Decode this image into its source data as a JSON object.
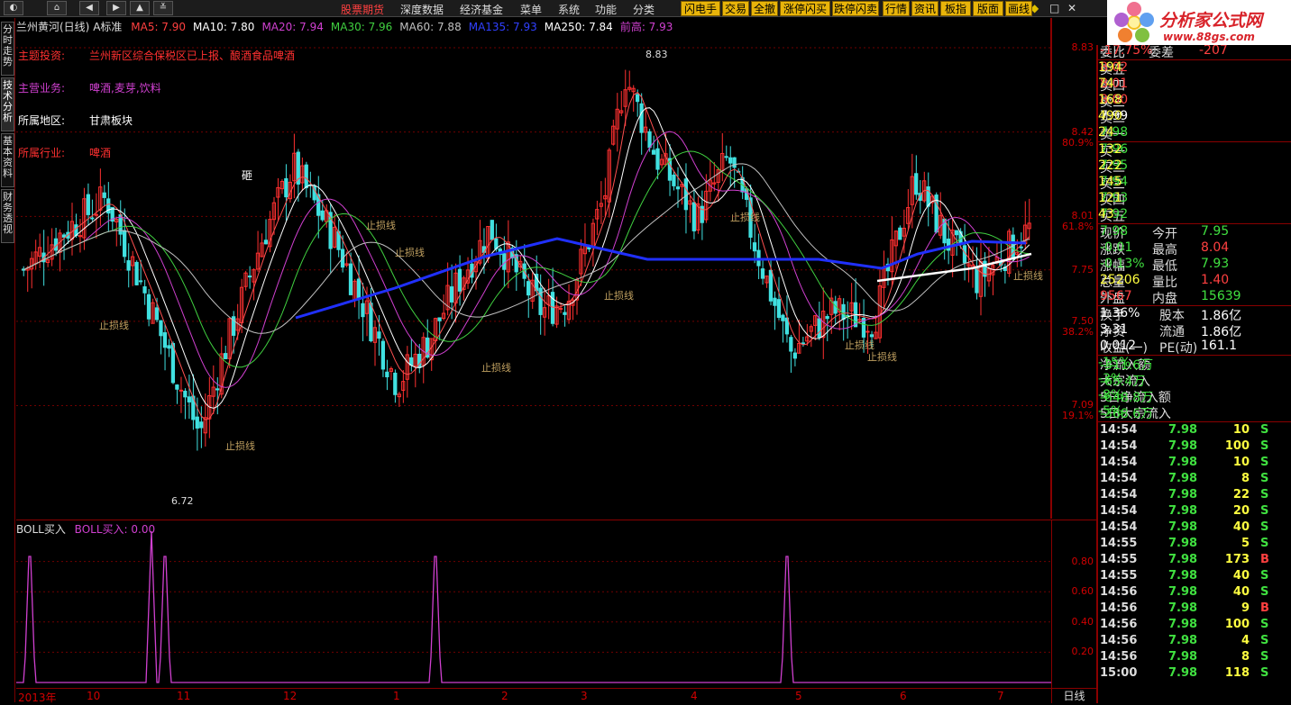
{
  "toolbar": {
    "nav_icons": [
      "home-icon",
      "back-icon",
      "forward-icon",
      "up-icon",
      "down-icon",
      "menu-expand-icon"
    ],
    "menus": [
      "股票期货",
      "深度数据",
      "经济基金",
      "菜单",
      "系统",
      "功能",
      "分类"
    ],
    "buttons": [
      "闪电手",
      "交易",
      "全撤",
      "涨停闪买",
      "跌停闪卖",
      "行情",
      "资讯",
      "板指",
      "版面",
      "画线"
    ],
    "window_controls": [
      "◆",
      "□",
      "✕"
    ]
  },
  "logo": {
    "title": "分析家公式网",
    "url": "www.88gs.com"
  },
  "side_tabs": [
    "分时走势",
    "技术分析",
    "基本资料",
    "财务透视"
  ],
  "main_chart": {
    "stock_title": "兰州黄河(日线)",
    "mode": "A标准",
    "ma_labels": [
      {
        "text": "MA5: 7.90",
        "color": "#ff4040"
      },
      {
        "text": "MA10: 7.80",
        "color": "#ffffff"
      },
      {
        "text": "MA20: 7.94",
        "color": "#d040d0"
      },
      {
        "text": "MA30: 7.96",
        "color": "#40d040"
      },
      {
        "text": "MA60: 7.88",
        "color": "#c0c0c0"
      },
      {
        "text": "MA135: 7.93",
        "color": "#3040ff"
      },
      {
        "text": "MA250: 7.84",
        "color": "#ffffff"
      },
      {
        "text": "前高: 7.93",
        "color": "#d040d0"
      }
    ],
    "info": [
      {
        "label": "主题投资:",
        "value": "兰州新区综合保税区已上报、酿酒食品啤酒",
        "lcolor": "#ff3030",
        "vcolor": "#ff3030"
      },
      {
        "label": "主营业务:",
        "value": "啤酒,麦芽,饮料",
        "lcolor": "#d040d0",
        "vcolor": "#d040d0"
      },
      {
        "label": "所属地区:",
        "value": "甘肃板块",
        "lcolor": "#ffffff",
        "vcolor": "#ffffff"
      },
      {
        "label": "所属行业:",
        "value": "啤酒",
        "lcolor": "#ff3030",
        "vcolor": "#ff3030"
      }
    ],
    "annotations": {
      "high": "8.83",
      "low": "6.72",
      "stop": "止损线",
      "char": "砸"
    },
    "y_labels": [
      "8.83",
      "8.42",
      "80.9%",
      "8.01",
      "61.8%",
      "7.75",
      "7.50",
      "38.2%",
      "7.09",
      "19.1%"
    ]
  },
  "sub_chart": {
    "title": "BOLL买入",
    "value_label": "BOLL买入: 0.00",
    "y_labels": [
      "0.80",
      "0.60",
      "0.40",
      "0.20"
    ]
  },
  "date_axis": [
    "2013年",
    "10",
    "11",
    "12",
    "1",
    "2",
    "3",
    "4",
    "5",
    "6",
    "7"
  ],
  "period": "日线",
  "quote": {
    "header": {
      "label": "委比",
      "value": "-17.75%",
      "label2": "委差",
      "value2": "-207"
    },
    "asks": [
      {
        "label": "卖五",
        "price": "8.02",
        "vol": "194"
      },
      {
        "label": "卖四",
        "price": "8.01",
        "vol": "74"
      },
      {
        "label": "卖三",
        "price": "8.00",
        "vol": "168"
      },
      {
        "label": "卖二",
        "price": "7.99",
        "vol": "490"
      },
      {
        "label": "卖一",
        "price": "7.98",
        "vol": "24"
      }
    ],
    "bids": [
      {
        "label": "买一",
        "price": "7.96",
        "vol": "132"
      },
      {
        "label": "买二",
        "price": "7.95",
        "vol": "222"
      },
      {
        "label": "买三",
        "price": "7.94",
        "vol": "145"
      },
      {
        "label": "买四",
        "price": "7.93",
        "vol": "121"
      },
      {
        "label": "买五",
        "price": "7.92",
        "vol": "43"
      }
    ],
    "stats": [
      {
        "l1": "现价",
        "v1": "7.98",
        "l2": "今开",
        "v2": "7.95",
        "c1": "#40e040",
        "c2": "#40e040"
      },
      {
        "l1": "涨跌",
        "v1": "-0.01",
        "l2": "最高",
        "v2": "8.04",
        "c1": "#40e040",
        "c2": "#ff4040"
      },
      {
        "l1": "涨幅",
        "v1": "-0.13%",
        "l2": "最低",
        "v2": "7.93",
        "c1": "#40e040",
        "c2": "#40e040"
      },
      {
        "l1": "总量",
        "v1": "25206",
        "l2": "量比",
        "v2": "1.40",
        "c1": "#ffff40",
        "c2": "#ff4040"
      },
      {
        "l1": "外盘",
        "v1": "9567",
        "l2": "内盘",
        "v2": "15639",
        "c1": "#ff4040",
        "c2": "#40e040"
      }
    ],
    "stats2": [
      {
        "l1": "换手",
        "v1": "1.36%",
        "l2": "股本",
        "v2": "1.86亿"
      },
      {
        "l1": "净资",
        "v1": "3.31",
        "l2": "流通",
        "v2": "1.86亿"
      },
      {
        "l1": "收益(一)",
        "v1": "0.012",
        "l2": "PE(动)",
        "v2": "161.1"
      }
    ],
    "flows": [
      {
        "label": "净流入额",
        "value": "-311.6万",
        "pct": "-15%"
      },
      {
        "label": "大宗流入",
        "value": "-65.4万",
        "pct": "-3%"
      },
      {
        "label": "5日净流入额",
        "value": "-648.8万",
        "pct": "-8%"
      },
      {
        "label": "5日大宗流入",
        "value": "-368.6万",
        "pct": "-5%"
      }
    ],
    "ticks": [
      {
        "time": "14:54",
        "price": "7.98",
        "vol": "10",
        "side": "S"
      },
      {
        "time": "14:54",
        "price": "7.98",
        "vol": "100",
        "side": "S"
      },
      {
        "time": "14:54",
        "price": "7.98",
        "vol": "10",
        "side": "S"
      },
      {
        "time": "14:54",
        "price": "7.98",
        "vol": "8",
        "side": "S"
      },
      {
        "time": "14:54",
        "price": "7.98",
        "vol": "22",
        "side": "S"
      },
      {
        "time": "14:54",
        "price": "7.98",
        "vol": "20",
        "side": "S"
      },
      {
        "time": "14:54",
        "price": "7.98",
        "vol": "40",
        "side": "S"
      },
      {
        "time": "14:55",
        "price": "7.98",
        "vol": "5",
        "side": "S"
      },
      {
        "time": "14:55",
        "price": "7.98",
        "vol": "173",
        "side": "B"
      },
      {
        "time": "14:55",
        "price": "7.98",
        "vol": "40",
        "side": "S"
      },
      {
        "time": "14:56",
        "price": "7.98",
        "vol": "40",
        "side": "S"
      },
      {
        "time": "14:56",
        "price": "7.98",
        "vol": "9",
        "side": "B"
      },
      {
        "time": "14:56",
        "price": "7.98",
        "vol": "100",
        "side": "S"
      },
      {
        "time": "14:56",
        "price": "7.98",
        "vol": "4",
        "side": "S"
      },
      {
        "time": "14:56",
        "price": "7.98",
        "vol": "8",
        "side": "S"
      },
      {
        "time": "15:00",
        "price": "7.98",
        "vol": "118",
        "side": "S"
      }
    ]
  }
}
